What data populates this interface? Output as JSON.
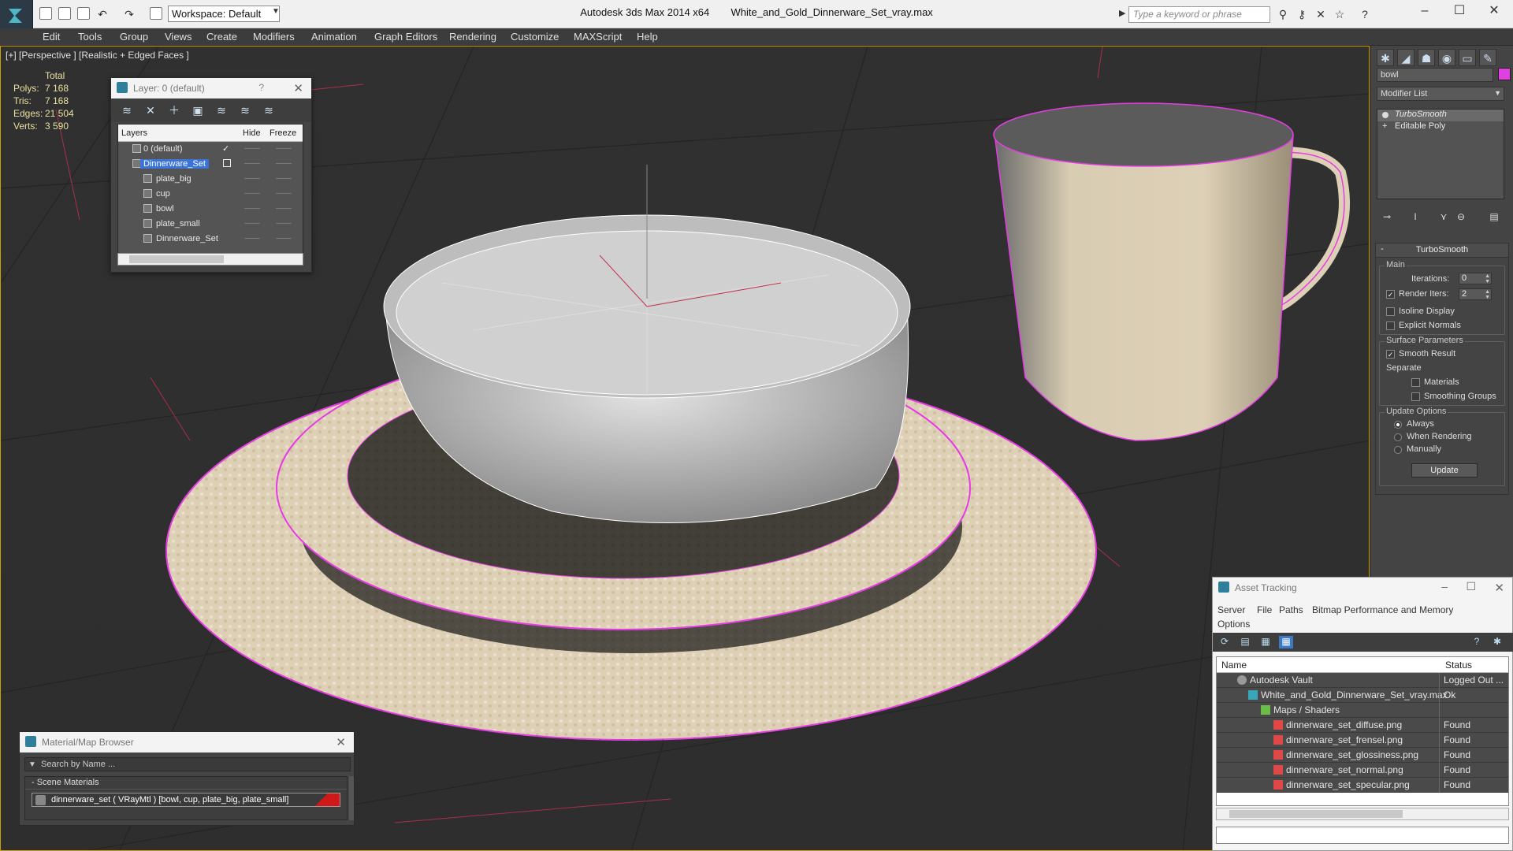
{
  "titlebar": {
    "workspace": "Workspace: Default",
    "app_title": "Autodesk 3ds Max  2014 x64",
    "file_name": "White_and_Gold_Dinnerware_Set_vray.max",
    "search_placeholder": "Type a keyword or phrase"
  },
  "menu": [
    "Edit",
    "Tools",
    "Group",
    "Views",
    "Create",
    "Modifiers",
    "Animation",
    "Graph Editors",
    "Rendering",
    "Customize",
    "MAXScript",
    "Help"
  ],
  "viewport": {
    "label": "[+] [Perspective ] [Realistic + Edged Faces ]",
    "stats": {
      "total_label": "Total",
      "rows": [
        {
          "k": "Polys:",
          "v": "7 168"
        },
        {
          "k": "Tris:",
          "v": "7 168"
        },
        {
          "k": "Edges:",
          "v": "21 504"
        },
        {
          "k": "Verts:",
          "v": "3 590"
        }
      ]
    },
    "wire_color": "#e63ce6",
    "selection_color": "#ffffff"
  },
  "layer_panel": {
    "title": "Layer: 0 (default)",
    "help": "?",
    "col_layers": "Layers",
    "col_hide": "Hide",
    "col_freeze": "Freeze",
    "rows": [
      {
        "name": "0 (default)",
        "indent": 0
      },
      {
        "name": "Dinnerware_Set",
        "indent": 0
      },
      {
        "name": "plate_big",
        "indent": 1
      },
      {
        "name": "cup",
        "indent": 1
      },
      {
        "name": "bowl",
        "indent": 1
      },
      {
        "name": "plate_small",
        "indent": 1
      },
      {
        "name": "Dinnerware_Set",
        "indent": 1
      }
    ]
  },
  "command_panel": {
    "object_name": "bowl",
    "modifier_list": "Modifier List",
    "stack": [
      "TurboSmooth",
      "Editable Poly"
    ],
    "rollout_title": "TurboSmooth",
    "main_group": "Main",
    "iterations_label": "Iterations:",
    "iterations_value": "0",
    "render_iters_label": "Render Iters:",
    "render_iters_value": "2",
    "isoline": "Isoline Display",
    "explicit_normals": "Explicit Normals",
    "surface_group": "Surface Parameters",
    "smooth_result": "Smooth Result",
    "separate": "Separate",
    "materials": "Materials",
    "smoothing_groups": "Smoothing Groups",
    "update_group": "Update Options",
    "always": "Always",
    "when_rendering": "When Rendering",
    "manually": "Manually",
    "update_btn": "Update"
  },
  "asset_tracking": {
    "title": "Asset Tracking",
    "menu": [
      "Server",
      "File",
      "Paths",
      "Bitmap Performance and Memory",
      "Options"
    ],
    "col_name": "Name",
    "col_status": "Status",
    "rows": [
      {
        "name": "Autodesk Vault",
        "status": "Logged Out ...",
        "indent": 0
      },
      {
        "name": "White_and_Gold_Dinnerware_Set_vray.max",
        "status": "Ok",
        "indent": 1
      },
      {
        "name": "Maps / Shaders",
        "status": "",
        "indent": 2
      },
      {
        "name": "dinnerware_set_diffuse.png",
        "status": "Found",
        "indent": 3
      },
      {
        "name": "dinnerware_set_frensel.png",
        "status": "Found",
        "indent": 3
      },
      {
        "name": "dinnerware_set_glossiness.png",
        "status": "Found",
        "indent": 3
      },
      {
        "name": "dinnerware_set_normal.png",
        "status": "Found",
        "indent": 3
      },
      {
        "name": "dinnerware_set_specular.png",
        "status": "Found",
        "indent": 3
      }
    ]
  },
  "material_browser": {
    "title": "Material/Map Browser",
    "search_placeholder": "Search by Name ...",
    "section": "- Scene Materials",
    "item": "dinnerware_set  ( VRayMtl ) [bowl, cup, plate_big, plate_small]"
  }
}
